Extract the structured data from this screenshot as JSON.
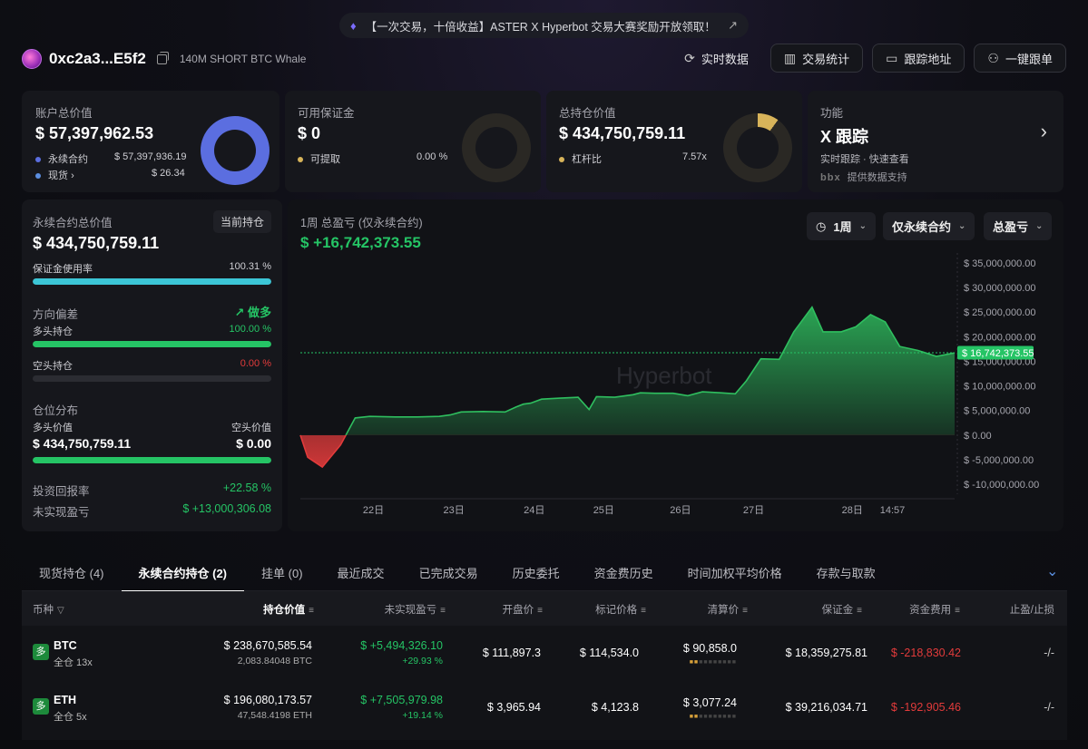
{
  "banner": {
    "text": "【一次交易，十倍收益】ASTER X Hyperbot 交易大赛奖励开放领取！"
  },
  "header": {
    "address": "0xc2a3...E5f2",
    "tag": "140M SHORT BTC Whale"
  },
  "toolbar": {
    "realtime": "实时数据",
    "stats": "交易统计",
    "track": "跟踪地址",
    "copy": "一键跟单"
  },
  "account": {
    "label": "账户总价值",
    "value": "$ 57,397,962.53",
    "perp_label": "永续合约",
    "perp_value": "$ 57,397,936.19",
    "spot_label": "现货",
    "spot_value": "$ 26.34"
  },
  "margin": {
    "label": "可用保证金",
    "value": "$ 0",
    "withdraw_label": "可提取",
    "withdraw_value": "0.00 %"
  },
  "position": {
    "label": "总持仓价值",
    "value": "$ 434,750,759.11",
    "leverage_label": "杠杆比",
    "leverage_value": "7.57x",
    "leverage_fraction": 0.1
  },
  "features": {
    "label": "功能",
    "title": "X 跟踪",
    "sub": "实时跟踪 · 快速查看",
    "powered": "提供数据支持",
    "logo": "b̶b̶x̶"
  },
  "perp_panel": {
    "label": "永续合约总价值",
    "badge": "当前持仓",
    "value": "$ 434,750,759.11",
    "margin_use_label": "保证金使用率",
    "margin_use_value": "100.31 %",
    "margin_use_fraction": 1.0,
    "direction_label": "方向偏差",
    "direction_value": "做多",
    "long_label": "多头持仓",
    "long_value": "100.00 %",
    "long_fraction": 1.0,
    "short_label": "空头持仓",
    "short_value": "0.00 %",
    "short_fraction": 0.0,
    "dist_label": "仓位分布",
    "long_val_label": "多头价值",
    "short_val_label": "空头价值",
    "long_val": "$ 434,750,759.11",
    "short_val": "$ 0.00",
    "dist_fraction": 1.0,
    "roi_label": "投资回报率",
    "roi_value": "+22.58 %",
    "upnl_label": "未实现盈亏",
    "upnl_value": "$ +13,000,306.08"
  },
  "chart_panel": {
    "title": "1周 总盈亏 (仅永续合约)",
    "value": "$ +16,742,373.55",
    "sel_period": "1周",
    "sel_scope": "仅永续合约",
    "sel_metric": "总盈亏",
    "watermark": "Hyperbot",
    "current_label": "$ 16,742,373.55"
  },
  "chart_data": {
    "type": "area",
    "ylim": [
      -12000000,
      37000000
    ],
    "yticks": [
      35000000,
      30000000,
      25000000,
      20000000,
      15000000,
      10000000,
      5000000,
      0,
      -5000000,
      -10000000
    ],
    "ytick_labels": [
      "$ 35,000,000.00",
      "$ 30,000,000.00",
      "$ 25,000,000.00",
      "$ 20,000,000.00",
      "$ 15,000,000.00",
      "$ 10,000,000.00",
      "$ 5,000,000.00",
      "$ 0.00",
      "$ -5,000,000.00",
      "$ -10,000,000.00"
    ],
    "xticks": [
      {
        "t": 1.0,
        "label": "22日"
      },
      {
        "t": 2.1,
        "label": "23日"
      },
      {
        "t": 3.2,
        "label": "24日"
      },
      {
        "t": 4.15,
        "label": "25日"
      },
      {
        "t": 5.2,
        "label": "26日"
      },
      {
        "t": 6.2,
        "label": "27日"
      },
      {
        "t": 7.55,
        "label": "28日"
      },
      {
        "t": 8.1,
        "label": "14:57"
      }
    ],
    "current_value": 16742373,
    "points": [
      [
        0,
        0
      ],
      [
        0.1,
        -4500000
      ],
      [
        0.3,
        -6500000
      ],
      [
        0.55,
        -2000000
      ],
      [
        0.75,
        3500000
      ],
      [
        0.95,
        3800000
      ],
      [
        1.3,
        3700000
      ],
      [
        1.6,
        3700000
      ],
      [
        1.9,
        3800000
      ],
      [
        2.05,
        4100000
      ],
      [
        2.2,
        4700000
      ],
      [
        2.5,
        4800000
      ],
      [
        2.8,
        4700000
      ],
      [
        2.95,
        5700000
      ],
      [
        3.05,
        6300000
      ],
      [
        3.15,
        6500000
      ],
      [
        3.3,
        7300000
      ],
      [
        3.55,
        7500000
      ],
      [
        3.8,
        7700000
      ],
      [
        3.95,
        5200000
      ],
      [
        4.05,
        7800000
      ],
      [
        4.3,
        7700000
      ],
      [
        4.55,
        8200000
      ],
      [
        4.65,
        8600000
      ],
      [
        4.85,
        8500000
      ],
      [
        5.1,
        8500000
      ],
      [
        5.3,
        8000000
      ],
      [
        5.5,
        8800000
      ],
      [
        5.75,
        8600000
      ],
      [
        5.95,
        8400000
      ],
      [
        6.1,
        11000000
      ],
      [
        6.3,
        15500000
      ],
      [
        6.55,
        15400000
      ],
      [
        6.75,
        21000000
      ],
      [
        7.0,
        26000000
      ],
      [
        7.15,
        21000000
      ],
      [
        7.4,
        21000000
      ],
      [
        7.6,
        22000000
      ],
      [
        7.8,
        24500000
      ],
      [
        8.0,
        23000000
      ],
      [
        8.2,
        18000000
      ],
      [
        8.45,
        17200000
      ],
      [
        8.7,
        16000000
      ],
      [
        8.95,
        16700000
      ]
    ]
  },
  "tabs": [
    "现货持仓 (4)",
    "永续合约持仓 (2)",
    "挂单 (0)",
    "最近成交",
    "已完成交易",
    "历史委托",
    "资金费历史",
    "时间加权平均价格",
    "存款与取款"
  ],
  "table": {
    "headers": [
      "币种",
      "持仓价值",
      "未实现盈亏",
      "开盘价",
      "标记价格",
      "清算价",
      "保证金",
      "资金费用",
      "止盈/止损"
    ],
    "rows": [
      {
        "badge": "多",
        "coin": "BTC",
        "lev": "全仓 13x",
        "value": "$ 238,670,585.54",
        "size": "2,083.84048 BTC",
        "pnl": "$ +5,494,326.10",
        "pnl_pct": "+29.93 %",
        "entry": "$ 111,897.3",
        "mark": "$ 114,534.0",
        "liq": "$ 90,858.0",
        "margin": "$ 18,359,275.81",
        "funding": "$ -218,830.42",
        "tpsl": "-/-"
      },
      {
        "badge": "多",
        "coin": "ETH",
        "lev": "全仓 5x",
        "value": "$ 196,080,173.57",
        "size": "47,548.4198 ETH",
        "pnl": "$ +7,505,979.98",
        "pnl_pct": "+19.14 %",
        "entry": "$ 3,965.94",
        "mark": "$ 4,123.8",
        "liq": "$ 3,077.24",
        "margin": "$ 39,216,034.71",
        "funding": "$ -192,905.46",
        "tpsl": "-/-"
      }
    ]
  },
  "colors": {
    "donut_blue": "#5b6ee0",
    "donut_gold": "#d8b45a",
    "green": "#25c465",
    "red": "#e23b3b",
    "teal": "#3cc6d6"
  }
}
